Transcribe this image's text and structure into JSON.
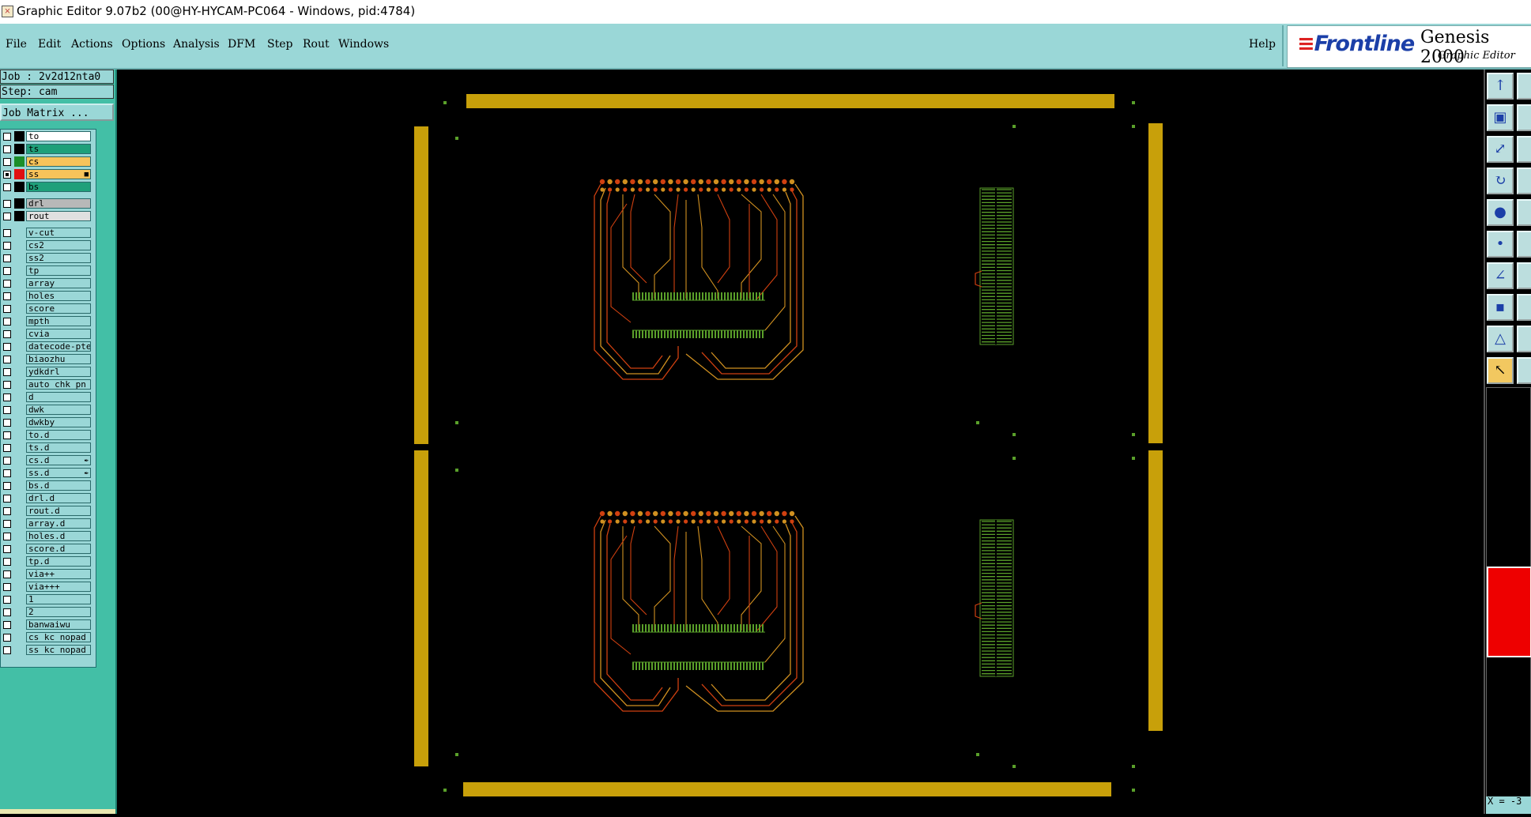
{
  "window": {
    "title": "Graphic Editor 9.07b2 (00@HY-HYCAM-PC064 - Windows, pid:4784)"
  },
  "menu": {
    "items": [
      "File",
      "Edit",
      "Actions",
      "Options",
      "Analysis",
      "DFM",
      "Step",
      "Rout",
      "Windows"
    ],
    "help": "Help"
  },
  "logo": {
    "brand": "Frontline",
    "product": "Genesis 2000",
    "subtitle": "Graphic Editor"
  },
  "job": {
    "job_label": "Job : 2v2d12nta0",
    "step_label": "Step: cam",
    "matrix_button": "Job Matrix ..."
  },
  "layers": [
    {
      "name": "to",
      "color": "#000000",
      "bg": "#ffffff",
      "checked": false
    },
    {
      "name": "ts",
      "color": "#000000",
      "bg": "#1fa07a",
      "checked": false
    },
    {
      "name": "cs",
      "color": "#1b8f2a",
      "bg": "#f7c35a",
      "checked": false
    },
    {
      "name": "ss",
      "color": "#e01010",
      "bg": "#f7c35a",
      "checked": true,
      "marker": "■"
    },
    {
      "name": "bs",
      "color": "#000000",
      "bg": "#1fa07a",
      "checked": false
    },
    {
      "name": "drl",
      "color": "#000000",
      "bg": "#b8b8b8",
      "checked": false
    },
    {
      "name": "rout",
      "color": "#000000",
      "bg": "#e0e0e0",
      "checked": false
    },
    {
      "name": "v-cut"
    },
    {
      "name": "cs2"
    },
    {
      "name": "ss2"
    },
    {
      "name": "tp"
    },
    {
      "name": "array"
    },
    {
      "name": "holes"
    },
    {
      "name": "score"
    },
    {
      "name": "mpth"
    },
    {
      "name": "cvia"
    },
    {
      "name": "datecode-pte"
    },
    {
      "name": "biaozhu"
    },
    {
      "name": "ydkdrl"
    },
    {
      "name": "auto_chk_pn"
    },
    {
      "name": "d"
    },
    {
      "name": "dwk"
    },
    {
      "name": "dwkby"
    },
    {
      "name": "to.d"
    },
    {
      "name": "ts.d"
    },
    {
      "name": "cs.d",
      "marker": "✒"
    },
    {
      "name": "ss.d",
      "marker": "✒"
    },
    {
      "name": "bs.d"
    },
    {
      "name": "drl.d"
    },
    {
      "name": "rout.d"
    },
    {
      "name": "array.d"
    },
    {
      "name": "holes.d"
    },
    {
      "name": "score.d"
    },
    {
      "name": "tp.d"
    },
    {
      "name": "via++"
    },
    {
      "name": "via+++"
    },
    {
      "name": "1"
    },
    {
      "name": "2"
    },
    {
      "name": "banwaiwu"
    },
    {
      "name": "cs_kc_nopad"
    },
    {
      "name": "ss_kc_nopad"
    }
  ],
  "coordinate_readout": "X = -3",
  "colors": {
    "frame": "#c8a00a",
    "trace_red": "#d04010",
    "trace_orange": "#d09020",
    "pad_green": "#5aa02a",
    "background": "#000000",
    "panel": "#9ad7d7"
  },
  "toolbar_icons": [
    "move-icon",
    "copy-icon",
    "resize-icon",
    "rotate-icon",
    "snapshot-icon",
    "net-icon",
    "line-icon",
    "pad-icon",
    "triangle-icon",
    "pointer-icon"
  ]
}
